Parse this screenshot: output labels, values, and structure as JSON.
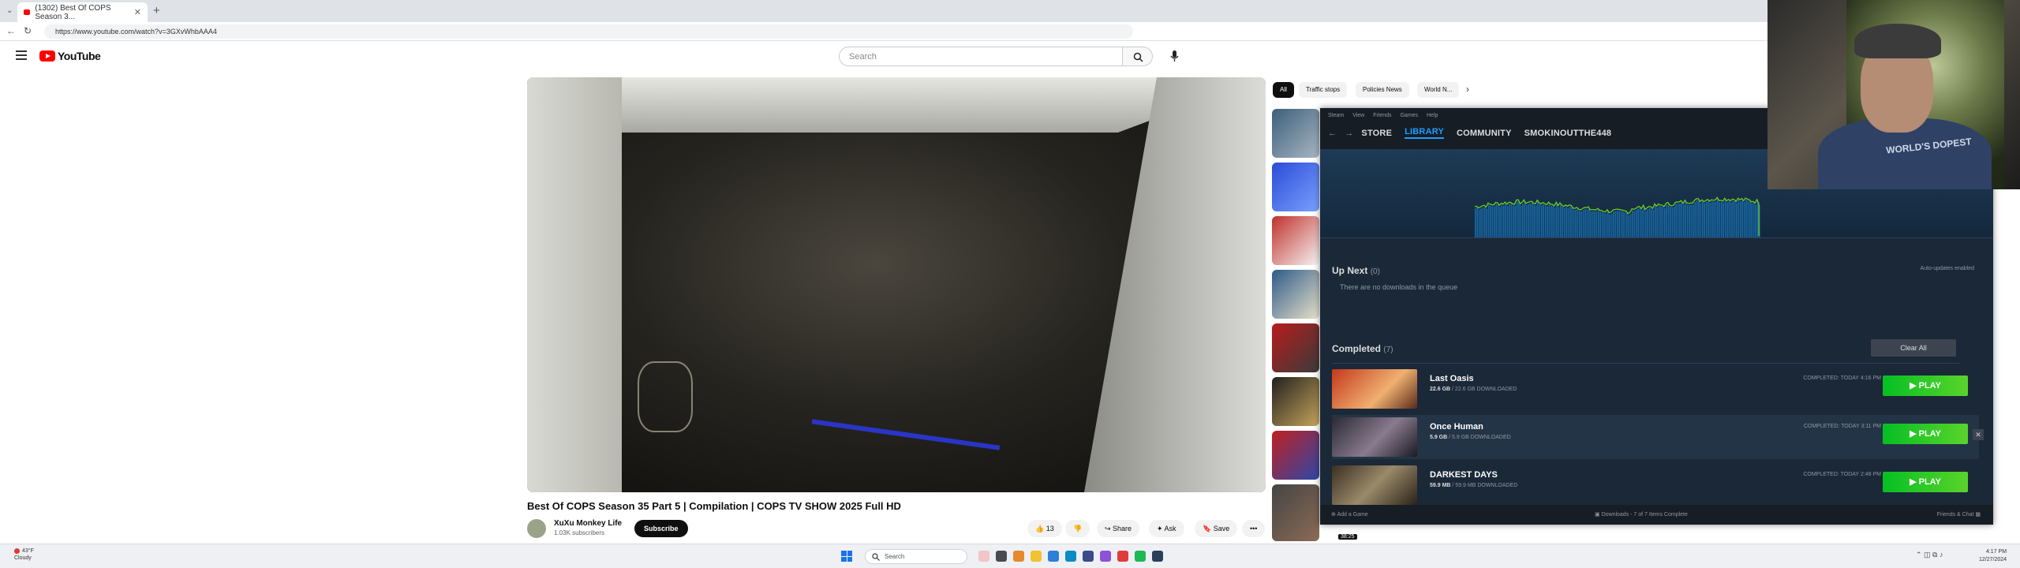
{
  "browser": {
    "tab_title": "(1302) Best Of COPS Season 3...",
    "url": "https://www.youtube.com/watch?v=3GXvWhbAAA4"
  },
  "youtube": {
    "logo": "YouTube",
    "search_placeholder": "Search",
    "chips": [
      "All",
      "Traffic stops",
      "Policies News",
      "World N..."
    ],
    "video_title": "Best Of COPS Season 35 Part 5 | Compilation | COPS TV SHOW 2025 Full HD",
    "channel_name": "XuXu Monkey Life",
    "channel_subs": "1.03K subscribers",
    "subscribe_label": "Subscribe",
    "like_count": "13",
    "share_label": "Share",
    "ask_label": "Ask",
    "save_label": "Save",
    "more_label": "•••",
    "thumb_duration": "38:25"
  },
  "steam": {
    "menu": [
      "Steam",
      "View",
      "Friends",
      "Games",
      "Help"
    ],
    "nav": [
      "STORE",
      "LIBRARY",
      "COMMUNITY",
      "SMOKINOUTTHE448"
    ],
    "up_next_label": "Up Next",
    "up_next_count": "(0)",
    "queue_empty": "There are no downloads in the queue",
    "auto_updates": "Auto-updates enabled",
    "completed_label": "Completed",
    "completed_count": "(7)",
    "clear_all": "Clear All",
    "games": [
      {
        "name": "Last Oasis",
        "downloaded": "22.6 GB",
        "size_suffix": " / 22.6 GB DOWNLOADED",
        "completed": "COMPLETED: TODAY 4:16 PM",
        "play": "PLAY"
      },
      {
        "name": "Once Human",
        "downloaded": "5.9 GB",
        "size_suffix": " / 5.9 GB DOWNLOADED",
        "completed": "COMPLETED: TODAY 3:11 PM",
        "play": "PLAY"
      },
      {
        "name": "DARKEST DAYS",
        "downloaded": "59.9 MB",
        "size_suffix": " / 59.9 MB DOWNLOADED",
        "completed": "COMPLETED: TODAY 2:48 PM",
        "play": "PLAY"
      }
    ],
    "footer_add": "Add a Game",
    "footer_downloads": "Downloads - 7 of 7 Items Complete",
    "footer_friends": "Friends & Chat"
  },
  "webcam": {
    "shirt_text": "WORLD'S DOPEST"
  },
  "taskbar": {
    "weather_temp": "43°F",
    "weather_desc": "Cloudy",
    "search_label": "Search",
    "time": "4:17 PM",
    "date": "12/27/2024"
  },
  "colors": {
    "steam_bg": "#1b2838",
    "steam_accent": "#1a9fff",
    "play_green": "#06bf24",
    "youtube_red": "#ff0000"
  }
}
